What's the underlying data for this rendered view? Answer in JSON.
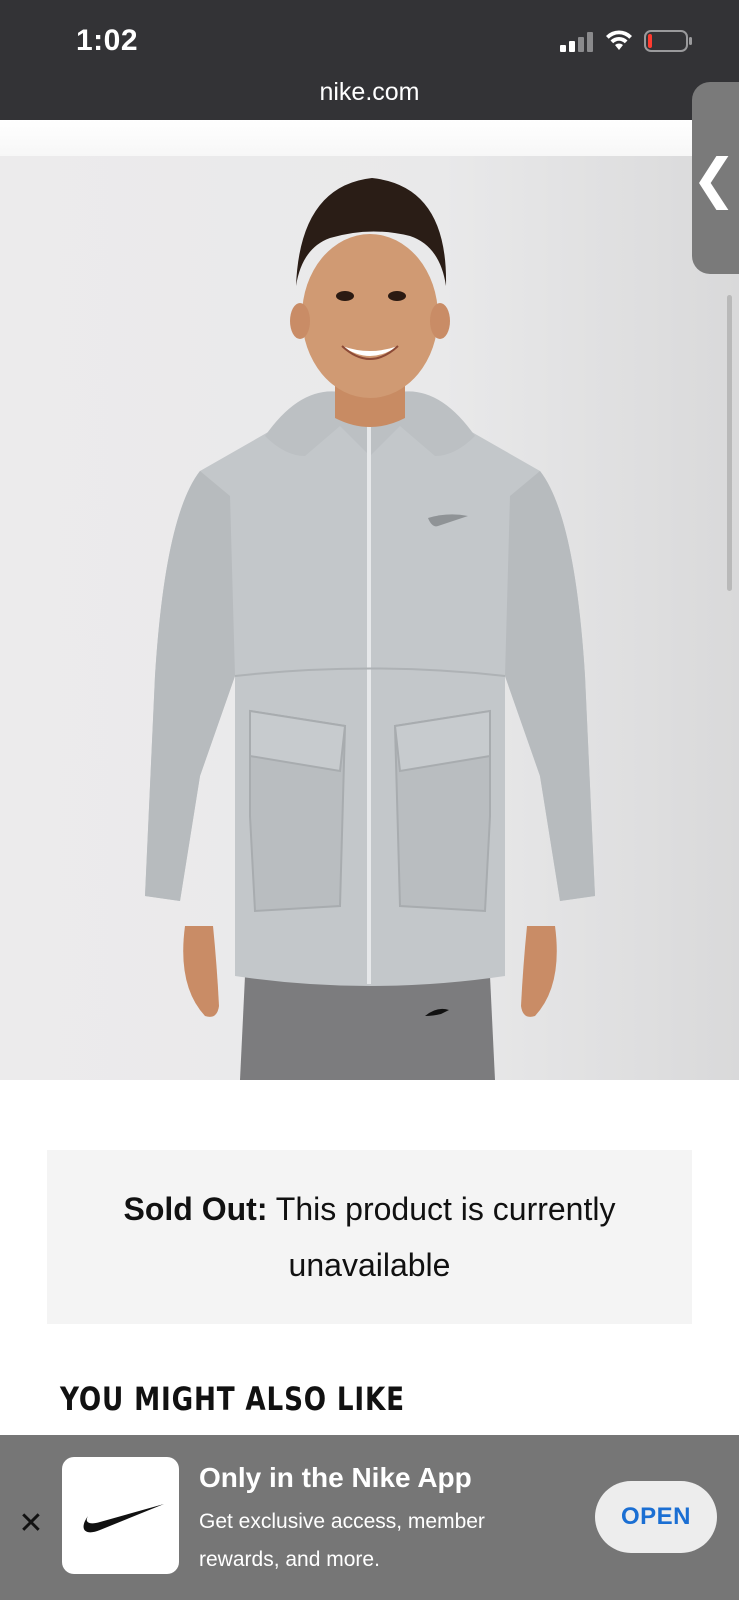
{
  "status_bar": {
    "time": "1:02",
    "signal_icon": "cellular-signal-icon",
    "wifi_icon": "wifi-icon",
    "battery_icon": "battery-low-icon"
  },
  "browser": {
    "url": "nike.com",
    "side_tab_icon": "chevron-left-icon",
    "side_tab_glyph": "❮"
  },
  "product": {
    "image_alt": "kid-wearing-grey-hooded-jacket"
  },
  "notice": {
    "label": "Sold Out:",
    "message": " This product is currently unavailable"
  },
  "recommendations": {
    "title": "YOU MIGHT ALSO LIKE"
  },
  "app_banner": {
    "close_glyph": "✕",
    "app_icon": "nike-swoosh-icon",
    "title": "Only in the Nike App",
    "subtitle": "Get exclusive access, member rewards, and more.",
    "open_label": "OPEN",
    "background_color": "#767676",
    "open_label_color": "#1b6fd3"
  }
}
